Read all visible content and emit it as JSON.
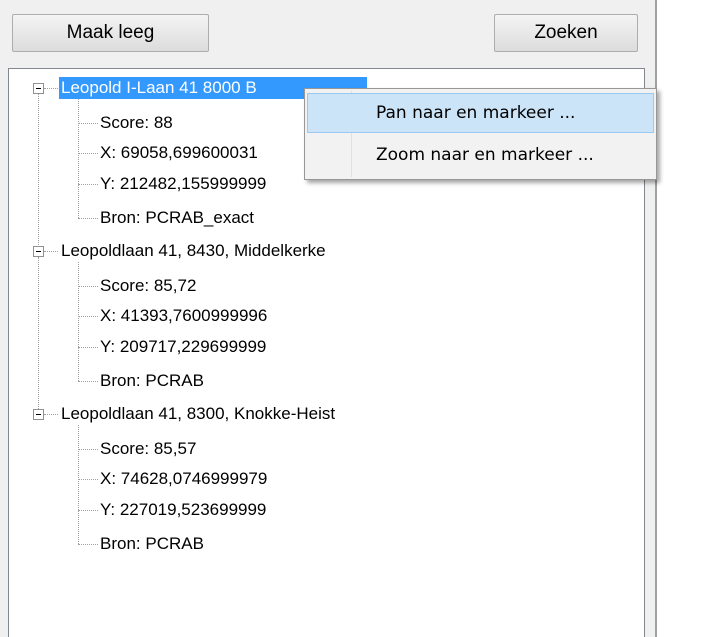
{
  "toolbar": {
    "clear_label": "Maak leeg",
    "search_label": "Zoeken"
  },
  "tree": {
    "results": [
      {
        "label": "Leopold I-Laan 41 8000 B",
        "selected": true,
        "children": [
          "Score: 88",
          "X: 69058,699600031",
          "Y: 212482,155999999",
          "Bron: PCRAB_exact"
        ]
      },
      {
        "label": "Leopoldlaan 41, 8430, Middelkerke",
        "selected": false,
        "children": [
          "Score: 85,72",
          "X: 41393,7600999996",
          "Y: 209717,229699999",
          "Bron: PCRAB"
        ]
      },
      {
        "label": "Leopoldlaan 41, 8300, Knokke-Heist",
        "selected": false,
        "children": [
          "Score: 85,57",
          "X: 74628,0746999979",
          "Y: 227019,523699999",
          "Bron: PCRAB"
        ]
      }
    ]
  },
  "context_menu": {
    "items": [
      {
        "label": "Pan naar en markeer ...",
        "highlighted": true
      },
      {
        "label": "Zoom naar en markeer ...",
        "highlighted": false
      }
    ]
  },
  "colors": {
    "selection": "#3399ff",
    "menu_highlight": "#cce4f7"
  }
}
